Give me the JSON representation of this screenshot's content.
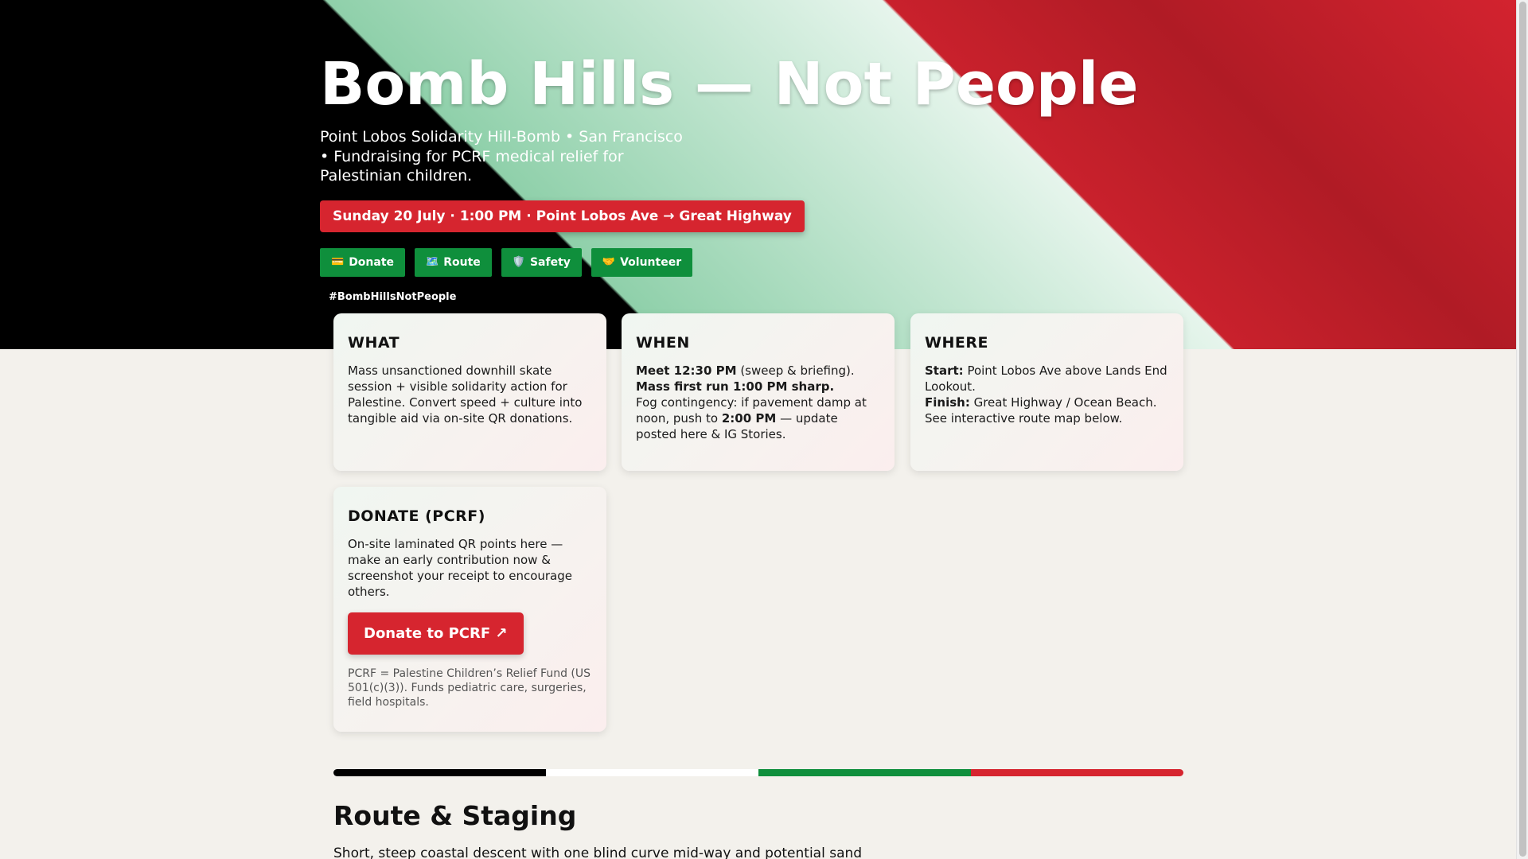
{
  "hero": {
    "title": "Bomb Hills — Not People",
    "subtitle": "Point Lobos Solidarity Hill-Bomb • San Francisco • Fundraising for PCRF medical relief for Palestinian children.",
    "date_pill": "Sunday 20 July · 1:00 PM · Point Lobos Ave → Great Highway",
    "nav": [
      {
        "icon": "💳",
        "icon_name": "credit-card-icon",
        "label": "Donate"
      },
      {
        "icon": "🗺️",
        "icon_name": "map-icon",
        "label": "Route"
      },
      {
        "icon": "🛡️",
        "icon_name": "shield-icon",
        "label": "Safety"
      },
      {
        "icon": "🤝",
        "icon_name": "handshake-icon",
        "label": "Volunteer"
      }
    ],
    "hashtag": "#BombHillsNotPeople"
  },
  "cards": {
    "what": {
      "heading": "WHAT",
      "body": "Mass unsanctioned downhill skate session + visible solidarity action for Palestine. Convert speed + culture into tangible aid via on-site QR donations."
    },
    "when": {
      "heading": "WHEN",
      "meet_bold": "Meet 12:30 PM",
      "meet_rest": " (sweep & briefing).",
      "first_run": "Mass first run 1:00 PM sharp.",
      "fog_pre": "Fog contingency: if pavement damp at noon, push to ",
      "fog_time": "2:00 PM",
      "fog_post": " — update posted here & IG Stories."
    },
    "where": {
      "heading": "WHERE",
      "start_label": "Start:",
      "start_text": " Point Lobos Ave above Lands End Lookout.",
      "finish_label": "Finish:",
      "finish_text": " Great Highway / Ocean Beach. See interactive route map below."
    },
    "donate": {
      "heading": "DONATE (PCRF)",
      "body": "On-site laminated QR points here — make an early contribution now & screenshot your receipt to encourage others.",
      "button": "Donate to PCRF ↗",
      "note": "PCRF = Palestine Children’s Relief Fund (US 501(c)(3)). Funds pediatric care, surgeries, field hospitals."
    }
  },
  "flag_colors": [
    "#000000",
    "#ffffff",
    "#0f8f3c",
    "#d6252f"
  ],
  "route": {
    "title": "Route & Staging",
    "intro": "Short, steep coastal descent with one blind curve mid-way and potential sand"
  },
  "colors": {
    "accent_red": "#d6252f",
    "accent_green": "#0f8f3c",
    "background": "#f3f1ec"
  }
}
